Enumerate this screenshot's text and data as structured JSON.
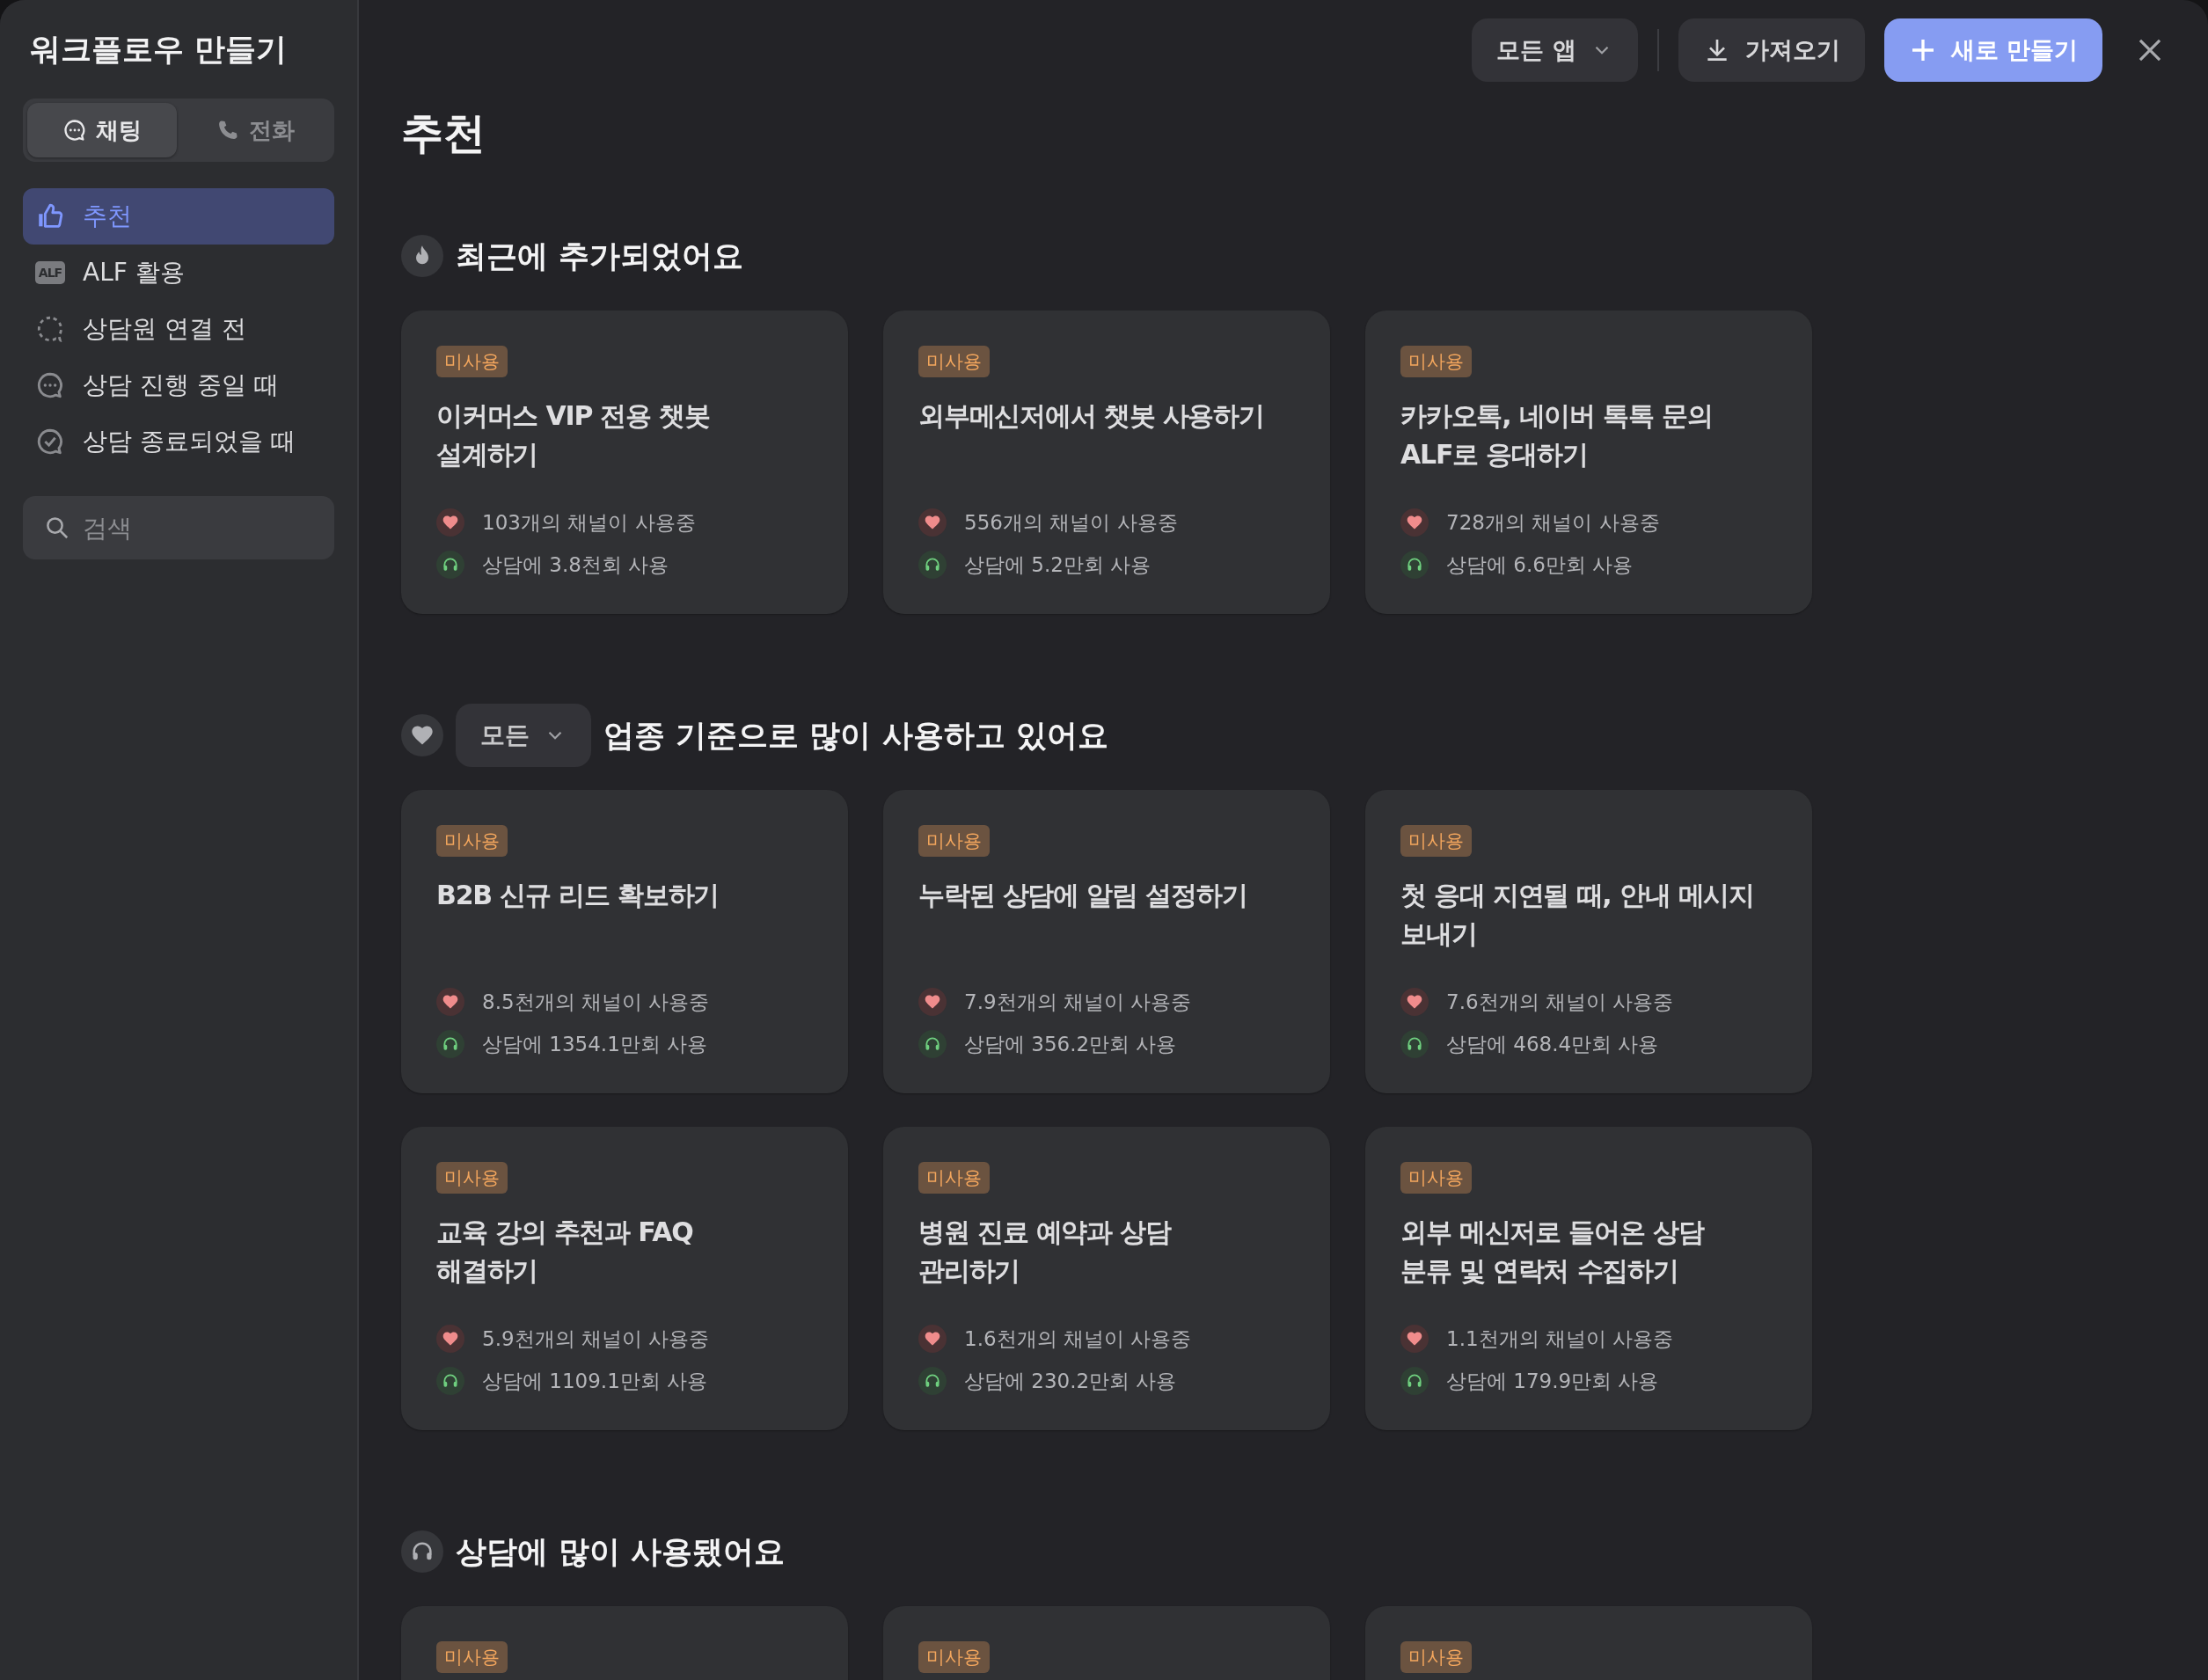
{
  "sidebar": {
    "title": "워크플로우 만들기",
    "tabs": [
      {
        "label": "채팅",
        "kind": "chat",
        "selected": true
      },
      {
        "label": "전화",
        "kind": "phone",
        "selected": false
      }
    ],
    "items": [
      {
        "label": "추천",
        "kind": "thumb",
        "selected": true
      },
      {
        "label": "ALF 활용",
        "kind": "badge",
        "badge": "ALF",
        "selected": false
      },
      {
        "label": "상담원 연결 전",
        "kind": "dashed",
        "selected": false
      },
      {
        "label": "상담 진행 중일 때",
        "kind": "chat",
        "selected": false
      },
      {
        "label": "상담 종료되었을 때",
        "kind": "check",
        "selected": false
      }
    ],
    "search": {
      "placeholder": "검색"
    }
  },
  "toolbar": {
    "app_filter": "모든 앱",
    "import_button": "가져오기",
    "new_button": "새로 만들기"
  },
  "page_title": "추천",
  "sections": [
    {
      "kind": "fire",
      "title": "최근에 추가되었어요",
      "cards": [
        {
          "tag": "미사용",
          "title": "이커머스 VIP 전용 챗봇\n설계하기",
          "channels": "103개의 채널이 사용중",
          "usage": "상담에 3.8천회 사용"
        },
        {
          "tag": "미사용",
          "title": "외부메신저에서 챗봇 사용하기",
          "channels": "556개의 채널이 사용중",
          "usage": "상담에 5.2만회 사용"
        },
        {
          "tag": "미사용",
          "title": "카카오톡, 네이버 톡톡 문의\nALF로 응대하기",
          "channels": "728개의 채널이 사용중",
          "usage": "상담에 6.6만회 사용"
        }
      ]
    },
    {
      "kind": "heart",
      "filter": "모든",
      "title": "업종 기준으로 많이 사용하고 있어요",
      "cards": [
        {
          "tag": "미사용",
          "title": "B2B 신규 리드 확보하기",
          "channels": "8.5천개의 채널이 사용중",
          "usage": "상담에 1354.1만회 사용"
        },
        {
          "tag": "미사용",
          "title": "누락된 상담에 알림 설정하기",
          "channels": "7.9천개의 채널이 사용중",
          "usage": "상담에 356.2만회 사용"
        },
        {
          "tag": "미사용",
          "title": "첫 응대 지연될 때, 안내 메시지\n보내기",
          "channels": "7.6천개의 채널이 사용중",
          "usage": "상담에 468.4만회 사용"
        },
        {
          "tag": "미사용",
          "title": "교육 강의 추천과 FAQ\n해결하기",
          "channels": "5.9천개의 채널이 사용중",
          "usage": "상담에 1109.1만회 사용"
        },
        {
          "tag": "미사용",
          "title": "병원 진료 예약과 상담\n관리하기",
          "channels": "1.6천개의 채널이 사용중",
          "usage": "상담에 230.2만회 사용"
        },
        {
          "tag": "미사용",
          "title": "외부 메신저로 들어온 상담\n분류 및 연락처 수집하기",
          "channels": "1.1천개의 채널이 사용중",
          "usage": "상담에 179.9만회 사용"
        }
      ]
    },
    {
      "kind": "headset",
      "title": "상담에 많이 사용됐어요",
      "cards": [
        {
          "tag": "미사용"
        },
        {
          "tag": "미사용"
        },
        {
          "tag": "미사용"
        }
      ]
    }
  ]
}
